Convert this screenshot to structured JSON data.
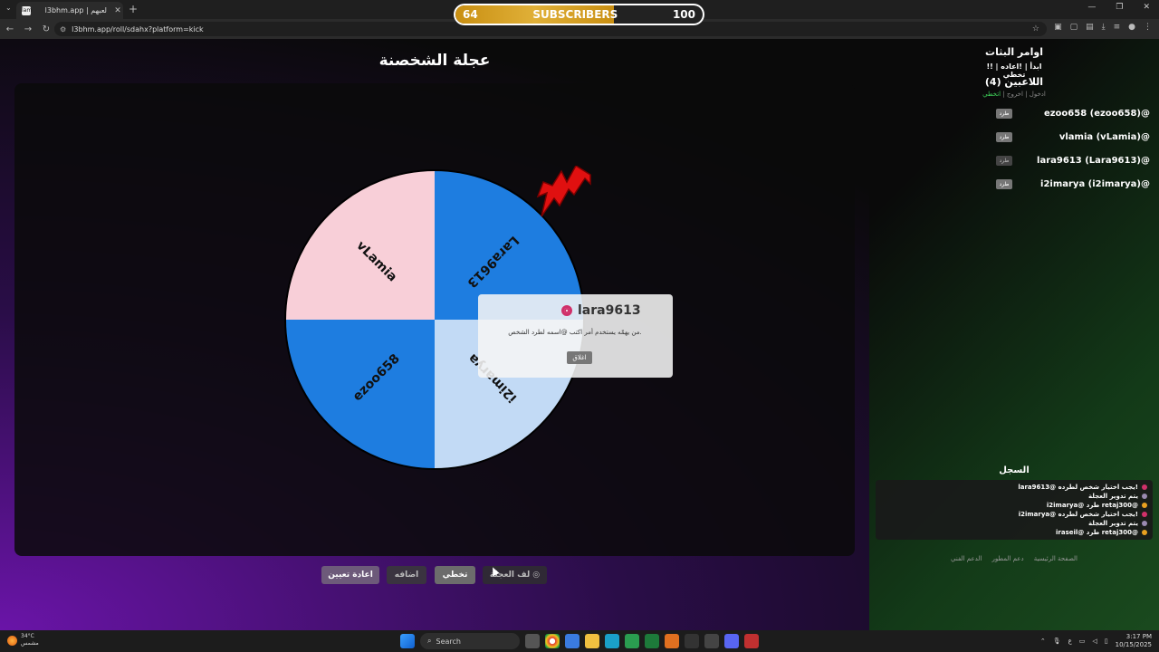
{
  "browser": {
    "tab_title": "l3bhm.app | لعبهم",
    "favicon_text": "lam",
    "new_tab": "+",
    "url": "l3bhm.app/roll/sdahx?platform=kick"
  },
  "subscribers": {
    "current": "64",
    "label": "SUBSCRIBERS",
    "goal": "100",
    "progress": 0.64
  },
  "wheel": {
    "title": "عجلة الشخصنة",
    "segments": [
      {
        "name": "Lara9613",
        "color": "#1e7de0"
      },
      {
        "name": "i2imarya",
        "color": "#c2daf5"
      },
      {
        "name": "ezoo658",
        "color": "#1e7de0"
      },
      {
        "name": "vLamia",
        "color": "#f8cfd8"
      }
    ]
  },
  "result": {
    "name": "lara9613",
    "message": "من يهمّه يستخدم أمر اكتب @اسمه لطرد الشخص.",
    "close_label": "اغلاق"
  },
  "actions": {
    "reset": "اعادة تعيين",
    "add": "اضافه",
    "skip": "تخطي",
    "spin": "لف العجلة"
  },
  "commands": {
    "title": "اوامر البثات",
    "list": "!ابدأ | !اعاده | !تخطي"
  },
  "players": {
    "title": "اللاعبين (4)",
    "join": "ادخول",
    "leave": "اخروج",
    "skip": "اتخطي",
    "kick_label": "طرد",
    "list": [
      {
        "name": "ezoo658 (ezoo658)@"
      },
      {
        "name": "vlamia (vLamia)@"
      },
      {
        "name": "lara9613 (Lara9613)@"
      },
      {
        "name": "i2imarya (i2imarya)@"
      }
    ]
  },
  "log": {
    "title": "السجل",
    "lines": [
      {
        "text": "lara9613@ يجب اختيار شخص لطرده!",
        "icon": "target-icon",
        "color": "#d0306a"
      },
      {
        "text": "يتم تدوير العجلة",
        "icon": "wheel-icon",
        "color": "#9a8ab0"
      },
      {
        "text": "i2imarya@ طرد retaj300@",
        "icon": "kick-icon",
        "color": "#e8a020"
      },
      {
        "text": "i2imarya@ يجب اختيار شخص لطرده!",
        "icon": "target-icon",
        "color": "#d0306a"
      },
      {
        "text": "يتم تدوير العجلة",
        "icon": "wheel-icon",
        "color": "#9a8ab0"
      },
      {
        "text": "iraseil@ طرد retaj300@",
        "icon": "kick-icon",
        "color": "#e8a020"
      }
    ]
  },
  "footer": {
    "home": "الصفحة الرئيسية",
    "support_dev": "دعم المطور",
    "tech_support": "الدعم الفني"
  },
  "taskbar": {
    "temperature": "34°C",
    "weather_desc": "مشمس",
    "search": "Search",
    "time": "3:17 PM",
    "date": "10/15/2025"
  }
}
